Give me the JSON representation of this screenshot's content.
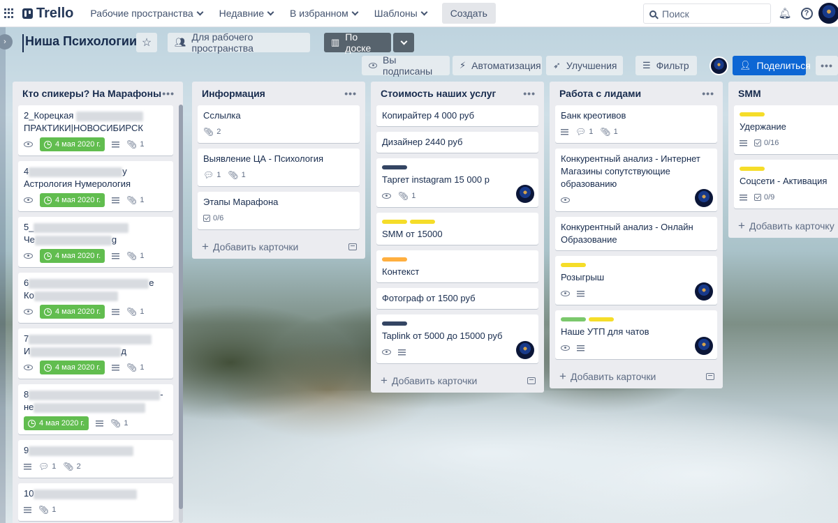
{
  "topbar": {
    "logo": "Trello",
    "menu": [
      {
        "label": "Рабочие пространства"
      },
      {
        "label": "Недавние"
      },
      {
        "label": "В избранном"
      },
      {
        "label": "Шаблоны"
      }
    ],
    "create_label": "Создать",
    "search_placeholder": "Поиск"
  },
  "board": {
    "title": "Ниша Психологии",
    "visibility_label": "Для рабочего пространства",
    "view_label": "По доске",
    "subscribed_label": "Вы подписаны",
    "automation_label": "Автоматизация",
    "powerups_label": "Улучшения",
    "filter_label": "Фильтр",
    "share_label": "Поделиться"
  },
  "colors": {
    "due_green": "#61bd4f",
    "label_yellow": "#f5dd29",
    "label_orange": "#ffaf3f",
    "label_green": "#7bc86c",
    "label_navy": "#344563",
    "share_blue": "#0c66d4"
  },
  "add_card_label": "Добавить карточки",
  "add_card_label_single": "Добавить карточку",
  "lists": [
    {
      "title": "Кто спикеры? На Марафоны",
      "cards": [
        {
          "title_a": "2_Корецкая",
          "title_b": "ПРАКТИКИ|НОВОСИБИРСК",
          "due": "4 мая 2020 г.",
          "attachments": "1"
        },
        {
          "title_a": "4",
          "title_a_tail": "у",
          "title_b": "Астрология Нумерология",
          "due": "4 мая 2020 г.",
          "attachments": "1"
        },
        {
          "title_a": "5_",
          "title_b": "Че",
          "title_b_tail": "g",
          "due": "4 мая 2020 г.",
          "attachments": "1"
        },
        {
          "title_a": "6",
          "title_a_tail": "е",
          "title_b": "Ко",
          "due": "4 мая 2020 г.",
          "attachments": "1"
        },
        {
          "title_a": "7",
          "title_b": "И",
          "title_b_tail": "д",
          "due": "4 мая 2020 г.",
          "attachments": "1"
        },
        {
          "title_a": "8",
          "title_a_tail": "-",
          "title_b": "не",
          "due": "4 мая 2020 г.",
          "attachments": "1"
        },
        {
          "title_a": "9",
          "comments": "1",
          "attachments": "2"
        },
        {
          "title_a": "10",
          "attachments": "1"
        }
      ]
    },
    {
      "title": "Информация",
      "cards": [
        {
          "title": "Сслылка",
          "attachments": "2"
        },
        {
          "title": "Выявление ЦА - Психология",
          "comments": "1",
          "attachments": "1"
        },
        {
          "title": "Этапы Марафона",
          "checklist": "0/6"
        }
      ]
    },
    {
      "title": "Стоимость наших услуг",
      "cards": [
        {
          "title": "Копирайтер 4 000 руб"
        },
        {
          "title": "Дизайнер 2440 руб"
        },
        {
          "title": "Таргет instagram 15 000 р",
          "attachments": "1"
        },
        {
          "title": "SMM от 15000"
        },
        {
          "title": "Контекст"
        },
        {
          "title": "Фотограф от 1500 руб"
        },
        {
          "title": "Taplink от 5000 до 15000 руб"
        }
      ]
    },
    {
      "title": "Работа с лидами",
      "cards": [
        {
          "title": "Банк креотивов",
          "comments": "1",
          "attachments": "1"
        },
        {
          "title": "Конкурентный анализ - Интернет Магазины сопутствующие образованию"
        },
        {
          "title": "Конкурентный анализ - Онлайн Образование"
        },
        {
          "title": "Розыгрыш"
        },
        {
          "title": "Наше УТП для чатов"
        }
      ]
    },
    {
      "title": "SMM",
      "cards": [
        {
          "title": "Удержание",
          "checklist": "0/16"
        },
        {
          "title": "Соцсети - Активация",
          "checklist": "0/9"
        }
      ]
    }
  ]
}
